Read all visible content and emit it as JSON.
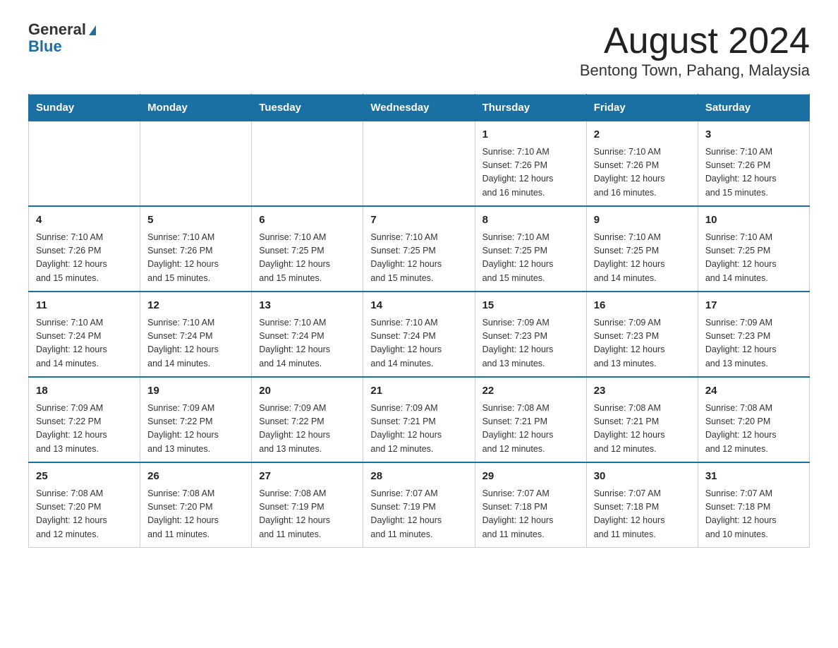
{
  "header": {
    "logo_line1": "General",
    "logo_line2": "Blue",
    "title": "August 2024",
    "subtitle": "Bentong Town, Pahang, Malaysia"
  },
  "days_of_week": [
    "Sunday",
    "Monday",
    "Tuesday",
    "Wednesday",
    "Thursday",
    "Friday",
    "Saturday"
  ],
  "weeks": [
    {
      "days": [
        {
          "num": "",
          "info": ""
        },
        {
          "num": "",
          "info": ""
        },
        {
          "num": "",
          "info": ""
        },
        {
          "num": "",
          "info": ""
        },
        {
          "num": "1",
          "info": "Sunrise: 7:10 AM\nSunset: 7:26 PM\nDaylight: 12 hours\nand 16 minutes."
        },
        {
          "num": "2",
          "info": "Sunrise: 7:10 AM\nSunset: 7:26 PM\nDaylight: 12 hours\nand 16 minutes."
        },
        {
          "num": "3",
          "info": "Sunrise: 7:10 AM\nSunset: 7:26 PM\nDaylight: 12 hours\nand 15 minutes."
        }
      ]
    },
    {
      "days": [
        {
          "num": "4",
          "info": "Sunrise: 7:10 AM\nSunset: 7:26 PM\nDaylight: 12 hours\nand 15 minutes."
        },
        {
          "num": "5",
          "info": "Sunrise: 7:10 AM\nSunset: 7:26 PM\nDaylight: 12 hours\nand 15 minutes."
        },
        {
          "num": "6",
          "info": "Sunrise: 7:10 AM\nSunset: 7:25 PM\nDaylight: 12 hours\nand 15 minutes."
        },
        {
          "num": "7",
          "info": "Sunrise: 7:10 AM\nSunset: 7:25 PM\nDaylight: 12 hours\nand 15 minutes."
        },
        {
          "num": "8",
          "info": "Sunrise: 7:10 AM\nSunset: 7:25 PM\nDaylight: 12 hours\nand 15 minutes."
        },
        {
          "num": "9",
          "info": "Sunrise: 7:10 AM\nSunset: 7:25 PM\nDaylight: 12 hours\nand 14 minutes."
        },
        {
          "num": "10",
          "info": "Sunrise: 7:10 AM\nSunset: 7:25 PM\nDaylight: 12 hours\nand 14 minutes."
        }
      ]
    },
    {
      "days": [
        {
          "num": "11",
          "info": "Sunrise: 7:10 AM\nSunset: 7:24 PM\nDaylight: 12 hours\nand 14 minutes."
        },
        {
          "num": "12",
          "info": "Sunrise: 7:10 AM\nSunset: 7:24 PM\nDaylight: 12 hours\nand 14 minutes."
        },
        {
          "num": "13",
          "info": "Sunrise: 7:10 AM\nSunset: 7:24 PM\nDaylight: 12 hours\nand 14 minutes."
        },
        {
          "num": "14",
          "info": "Sunrise: 7:10 AM\nSunset: 7:24 PM\nDaylight: 12 hours\nand 14 minutes."
        },
        {
          "num": "15",
          "info": "Sunrise: 7:09 AM\nSunset: 7:23 PM\nDaylight: 12 hours\nand 13 minutes."
        },
        {
          "num": "16",
          "info": "Sunrise: 7:09 AM\nSunset: 7:23 PM\nDaylight: 12 hours\nand 13 minutes."
        },
        {
          "num": "17",
          "info": "Sunrise: 7:09 AM\nSunset: 7:23 PM\nDaylight: 12 hours\nand 13 minutes."
        }
      ]
    },
    {
      "days": [
        {
          "num": "18",
          "info": "Sunrise: 7:09 AM\nSunset: 7:22 PM\nDaylight: 12 hours\nand 13 minutes."
        },
        {
          "num": "19",
          "info": "Sunrise: 7:09 AM\nSunset: 7:22 PM\nDaylight: 12 hours\nand 13 minutes."
        },
        {
          "num": "20",
          "info": "Sunrise: 7:09 AM\nSunset: 7:22 PM\nDaylight: 12 hours\nand 13 minutes."
        },
        {
          "num": "21",
          "info": "Sunrise: 7:09 AM\nSunset: 7:21 PM\nDaylight: 12 hours\nand 12 minutes."
        },
        {
          "num": "22",
          "info": "Sunrise: 7:08 AM\nSunset: 7:21 PM\nDaylight: 12 hours\nand 12 minutes."
        },
        {
          "num": "23",
          "info": "Sunrise: 7:08 AM\nSunset: 7:21 PM\nDaylight: 12 hours\nand 12 minutes."
        },
        {
          "num": "24",
          "info": "Sunrise: 7:08 AM\nSunset: 7:20 PM\nDaylight: 12 hours\nand 12 minutes."
        }
      ]
    },
    {
      "days": [
        {
          "num": "25",
          "info": "Sunrise: 7:08 AM\nSunset: 7:20 PM\nDaylight: 12 hours\nand 12 minutes."
        },
        {
          "num": "26",
          "info": "Sunrise: 7:08 AM\nSunset: 7:20 PM\nDaylight: 12 hours\nand 11 minutes."
        },
        {
          "num": "27",
          "info": "Sunrise: 7:08 AM\nSunset: 7:19 PM\nDaylight: 12 hours\nand 11 minutes."
        },
        {
          "num": "28",
          "info": "Sunrise: 7:07 AM\nSunset: 7:19 PM\nDaylight: 12 hours\nand 11 minutes."
        },
        {
          "num": "29",
          "info": "Sunrise: 7:07 AM\nSunset: 7:18 PM\nDaylight: 12 hours\nand 11 minutes."
        },
        {
          "num": "30",
          "info": "Sunrise: 7:07 AM\nSunset: 7:18 PM\nDaylight: 12 hours\nand 11 minutes."
        },
        {
          "num": "31",
          "info": "Sunrise: 7:07 AM\nSunset: 7:18 PM\nDaylight: 12 hours\nand 10 minutes."
        }
      ]
    }
  ]
}
